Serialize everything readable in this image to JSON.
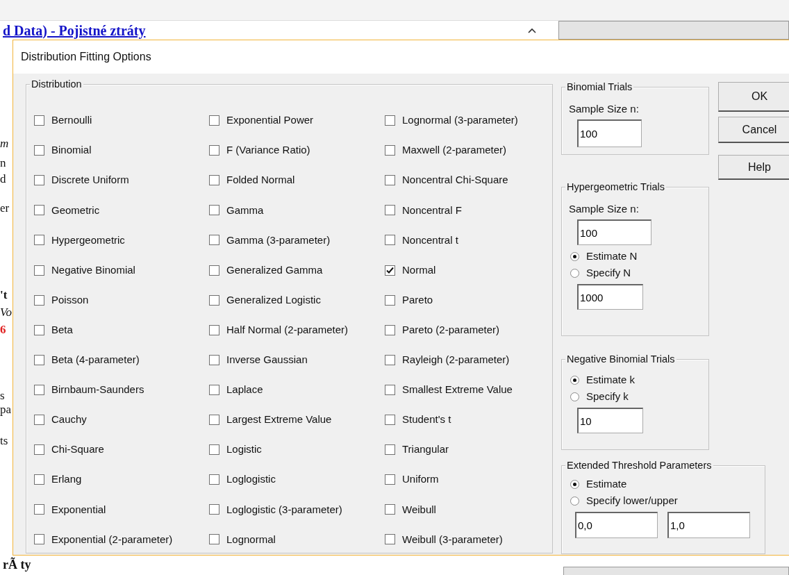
{
  "background_window": {
    "heading": "d Data) - Pojistné ztráty",
    "edge_fragments": [
      "m",
      "n",
      "d",
      "er",
      "'t",
      "Vo",
      "6",
      "s",
      "pa",
      "ts"
    ],
    "bottom_fragment": "rÃ ty"
  },
  "dialog": {
    "title": "Distribution Fitting Options",
    "distribution": {
      "legend": "Distribution",
      "columns": [
        [
          {
            "label": "Bernoulli",
            "checked": false
          },
          {
            "label": "Binomial",
            "checked": false
          },
          {
            "label": "Discrete Uniform",
            "checked": false
          },
          {
            "label": "Geometric",
            "checked": false
          },
          {
            "label": "Hypergeometric",
            "checked": false
          },
          {
            "label": "Negative Binomial",
            "checked": false
          },
          {
            "label": "Poisson",
            "checked": false
          },
          {
            "label": "Beta",
            "checked": false
          },
          {
            "label": "Beta (4-parameter)",
            "checked": false
          },
          {
            "label": "Birnbaum-Saunders",
            "checked": false
          },
          {
            "label": "Cauchy",
            "checked": false
          },
          {
            "label": "Chi-Square",
            "checked": false
          },
          {
            "label": "Erlang",
            "checked": false
          },
          {
            "label": "Exponential",
            "checked": false
          },
          {
            "label": "Exponential (2-parameter)",
            "checked": false
          }
        ],
        [
          {
            "label": "Exponential Power",
            "checked": false
          },
          {
            "label": "F (Variance Ratio)",
            "checked": false
          },
          {
            "label": "Folded Normal",
            "checked": false
          },
          {
            "label": "Gamma",
            "checked": false
          },
          {
            "label": "Gamma (3-parameter)",
            "checked": false
          },
          {
            "label": "Generalized Gamma",
            "checked": false
          },
          {
            "label": "Generalized Logistic",
            "checked": false
          },
          {
            "label": "Half Normal (2-parameter)",
            "checked": false
          },
          {
            "label": "Inverse Gaussian",
            "checked": false
          },
          {
            "label": "Laplace",
            "checked": false
          },
          {
            "label": "Largest Extreme Value",
            "checked": false
          },
          {
            "label": "Logistic",
            "checked": false
          },
          {
            "label": "Loglogistic",
            "checked": false
          },
          {
            "label": "Loglogistic (3-parameter)",
            "checked": false
          },
          {
            "label": "Lognormal",
            "checked": false
          }
        ],
        [
          {
            "label": "Lognormal (3-parameter)",
            "checked": false
          },
          {
            "label": "Maxwell (2-parameter)",
            "checked": false
          },
          {
            "label": "Noncentral Chi-Square",
            "checked": false
          },
          {
            "label": "Noncentral F",
            "checked": false
          },
          {
            "label": "Noncentral t",
            "checked": false
          },
          {
            "label": "Normal",
            "checked": true
          },
          {
            "label": "Pareto",
            "checked": false
          },
          {
            "label": "Pareto (2-parameter)",
            "checked": false
          },
          {
            "label": "Rayleigh (2-parameter)",
            "checked": false
          },
          {
            "label": "Smallest Extreme Value",
            "checked": false
          },
          {
            "label": "Student's t",
            "checked": false
          },
          {
            "label": "Triangular",
            "checked": false
          },
          {
            "label": "Uniform",
            "checked": false
          },
          {
            "label": "Weibull",
            "checked": false
          },
          {
            "label": "Weibull (3-parameter)",
            "checked": false
          }
        ]
      ]
    },
    "groups": [
      {
        "title": "Binomial Trials",
        "items": [
          {
            "kind": "label",
            "text": "Sample Size n:"
          },
          {
            "kind": "input",
            "value": "100"
          }
        ]
      },
      {
        "title": "Hypergeometric Trials",
        "items": [
          {
            "kind": "label",
            "text": "Sample Size n:"
          },
          {
            "kind": "input",
            "value": "100"
          },
          {
            "kind": "radio",
            "label": "Estimate N",
            "selected": true
          },
          {
            "kind": "radio",
            "label": "Specify N",
            "selected": false
          },
          {
            "kind": "input",
            "value": "1000"
          }
        ]
      },
      {
        "title": "Negative Binomial Trials",
        "items": [
          {
            "kind": "radio",
            "label": "Estimate k",
            "selected": true
          },
          {
            "kind": "radio",
            "label": "Specify k",
            "selected": false
          },
          {
            "kind": "input",
            "value": "10"
          }
        ]
      },
      {
        "title": "Extended Threshold Parameters",
        "items": [
          {
            "kind": "radio",
            "label": "Estimate",
            "selected": true
          },
          {
            "kind": "radio",
            "label": "Specify lower/upper",
            "selected": false
          },
          {
            "kind": "input_pair",
            "values": [
              "0,0",
              "1,0"
            ]
          }
        ]
      }
    ],
    "buttons": [
      "OK",
      "Cancel",
      "Help"
    ]
  }
}
